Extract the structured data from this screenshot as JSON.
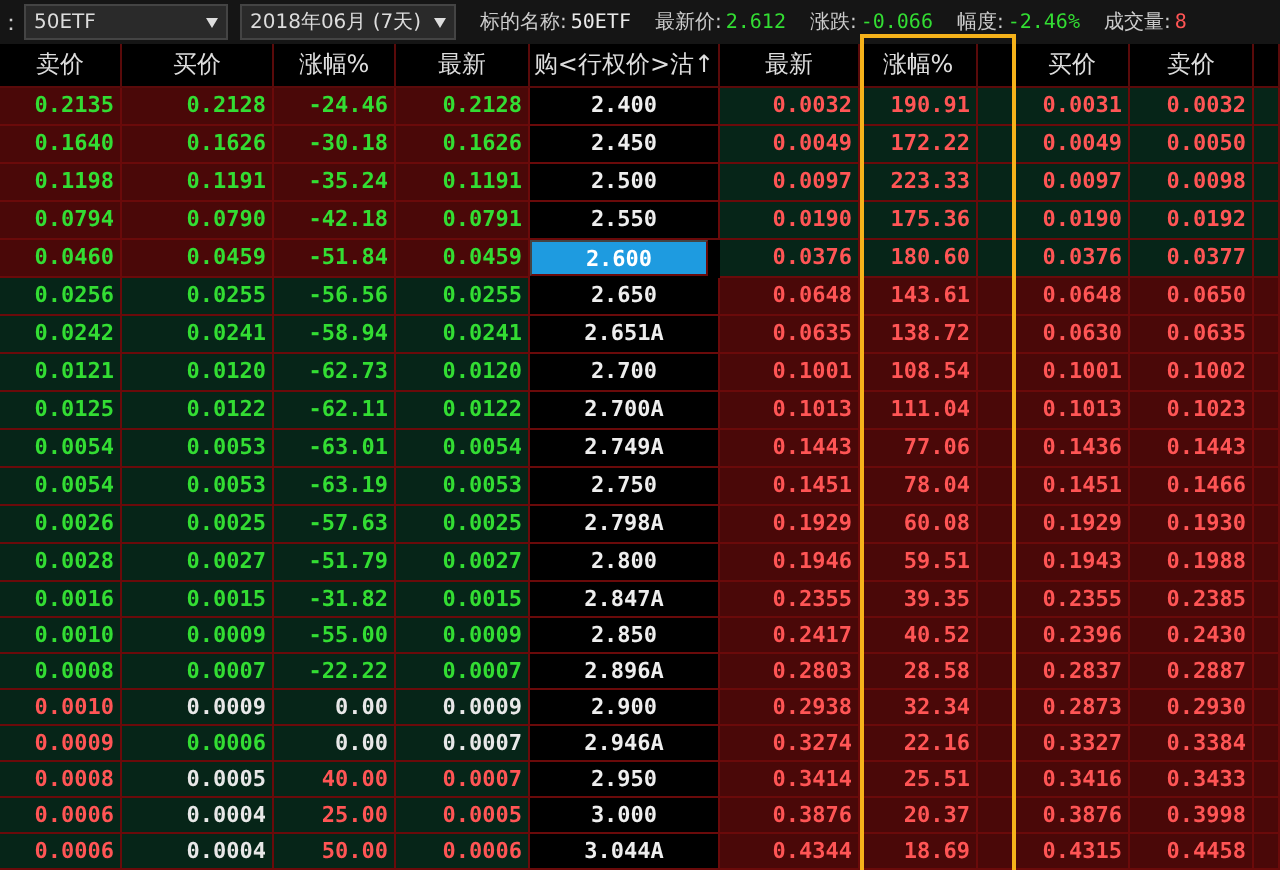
{
  "toolbar": {
    "cut_label": "：",
    "underlying_select": "50ETF",
    "month_select": "2018年06月 (7天)",
    "stats": [
      {
        "label": "标的名称:",
        "value": "50ETF",
        "kind": "flat"
      },
      {
        "label": "最新价:",
        "value": "2.612",
        "kind": "down"
      },
      {
        "label": "涨跌:",
        "value": "-0.066",
        "kind": "down"
      },
      {
        "label": "幅度:",
        "value": "-2.46%",
        "kind": "down"
      },
      {
        "label": "成交量:",
        "value": "8",
        "kind": "up"
      }
    ]
  },
  "table": {
    "columns": [
      "卖价",
      "买价",
      "涨幅%",
      "最新",
      "购<行权价>沽↑",
      "最新",
      "涨幅%",
      "买价",
      "卖价"
    ],
    "rows": [
      {
        "strike": "2.400",
        "selected": false,
        "call_itm": true,
        "call": [
          {
            "text": "0.2135",
            "kind": "down"
          },
          {
            "text": "0.2128",
            "kind": "down"
          },
          {
            "text": "-24.46",
            "kind": "down"
          },
          {
            "text": "0.2128",
            "kind": "down"
          }
        ],
        "put": [
          {
            "text": "0.0032",
            "kind": "up"
          },
          {
            "text": "190.91",
            "kind": "up"
          },
          {
            "text": "0.0031",
            "kind": "up"
          },
          {
            "text": "0.0032",
            "kind": "up"
          }
        ]
      },
      {
        "strike": "2.450",
        "selected": false,
        "call_itm": true,
        "call": [
          {
            "text": "0.1640",
            "kind": "down"
          },
          {
            "text": "0.1626",
            "kind": "down"
          },
          {
            "text": "-30.18",
            "kind": "down"
          },
          {
            "text": "0.1626",
            "kind": "down"
          }
        ],
        "put": [
          {
            "text": "0.0049",
            "kind": "up"
          },
          {
            "text": "172.22",
            "kind": "up"
          },
          {
            "text": "0.0049",
            "kind": "up"
          },
          {
            "text": "0.0050",
            "kind": "up"
          }
        ]
      },
      {
        "strike": "2.500",
        "selected": false,
        "call_itm": true,
        "call": [
          {
            "text": "0.1198",
            "kind": "down"
          },
          {
            "text": "0.1191",
            "kind": "down"
          },
          {
            "text": "-35.24",
            "kind": "down"
          },
          {
            "text": "0.1191",
            "kind": "down"
          }
        ],
        "put": [
          {
            "text": "0.0097",
            "kind": "up"
          },
          {
            "text": "223.33",
            "kind": "up"
          },
          {
            "text": "0.0097",
            "kind": "up"
          },
          {
            "text": "0.0098",
            "kind": "up"
          }
        ]
      },
      {
        "strike": "2.550",
        "selected": false,
        "call_itm": true,
        "call": [
          {
            "text": "0.0794",
            "kind": "down"
          },
          {
            "text": "0.0790",
            "kind": "down"
          },
          {
            "text": "-42.18",
            "kind": "down"
          },
          {
            "text": "0.0791",
            "kind": "down"
          }
        ],
        "put": [
          {
            "text": "0.0190",
            "kind": "up"
          },
          {
            "text": "175.36",
            "kind": "up"
          },
          {
            "text": "0.0190",
            "kind": "up"
          },
          {
            "text": "0.0192",
            "kind": "up"
          }
        ]
      },
      {
        "strike": "2.600",
        "selected": true,
        "call_itm": true,
        "call": [
          {
            "text": "0.0460",
            "kind": "down"
          },
          {
            "text": "0.0459",
            "kind": "down"
          },
          {
            "text": "-51.84",
            "kind": "down"
          },
          {
            "text": "0.0459",
            "kind": "down"
          }
        ],
        "put": [
          {
            "text": "0.0376",
            "kind": "up"
          },
          {
            "text": "180.60",
            "kind": "up"
          },
          {
            "text": "0.0376",
            "kind": "up"
          },
          {
            "text": "0.0377",
            "kind": "up"
          }
        ]
      },
      {
        "strike": "2.650",
        "selected": false,
        "call_itm": false,
        "call": [
          {
            "text": "0.0256",
            "kind": "down"
          },
          {
            "text": "0.0255",
            "kind": "down"
          },
          {
            "text": "-56.56",
            "kind": "down"
          },
          {
            "text": "0.0255",
            "kind": "down"
          }
        ],
        "put": [
          {
            "text": "0.0648",
            "kind": "up"
          },
          {
            "text": "143.61",
            "kind": "up"
          },
          {
            "text": "0.0648",
            "kind": "up"
          },
          {
            "text": "0.0650",
            "kind": "up"
          }
        ]
      },
      {
        "strike": "2.651A",
        "selected": false,
        "call_itm": false,
        "call": [
          {
            "text": "0.0242",
            "kind": "down"
          },
          {
            "text": "0.0241",
            "kind": "down"
          },
          {
            "text": "-58.94",
            "kind": "down"
          },
          {
            "text": "0.0241",
            "kind": "down"
          }
        ],
        "put": [
          {
            "text": "0.0635",
            "kind": "up"
          },
          {
            "text": "138.72",
            "kind": "up"
          },
          {
            "text": "0.0630",
            "kind": "up"
          },
          {
            "text": "0.0635",
            "kind": "up"
          }
        ]
      },
      {
        "strike": "2.700",
        "selected": false,
        "call_itm": false,
        "call": [
          {
            "text": "0.0121",
            "kind": "down"
          },
          {
            "text": "0.0120",
            "kind": "down"
          },
          {
            "text": "-62.73",
            "kind": "down"
          },
          {
            "text": "0.0120",
            "kind": "down"
          }
        ],
        "put": [
          {
            "text": "0.1001",
            "kind": "up"
          },
          {
            "text": "108.54",
            "kind": "up"
          },
          {
            "text": "0.1001",
            "kind": "up"
          },
          {
            "text": "0.1002",
            "kind": "up"
          }
        ]
      },
      {
        "strike": "2.700A",
        "selected": false,
        "call_itm": false,
        "call": [
          {
            "text": "0.0125",
            "kind": "down"
          },
          {
            "text": "0.0122",
            "kind": "down"
          },
          {
            "text": "-62.11",
            "kind": "down"
          },
          {
            "text": "0.0122",
            "kind": "down"
          }
        ],
        "put": [
          {
            "text": "0.1013",
            "kind": "up"
          },
          {
            "text": "111.04",
            "kind": "up"
          },
          {
            "text": "0.1013",
            "kind": "up"
          },
          {
            "text": "0.1023",
            "kind": "up"
          }
        ]
      },
      {
        "strike": "2.749A",
        "selected": false,
        "call_itm": false,
        "call": [
          {
            "text": "0.0054",
            "kind": "down"
          },
          {
            "text": "0.0053",
            "kind": "down"
          },
          {
            "text": "-63.01",
            "kind": "down"
          },
          {
            "text": "0.0054",
            "kind": "down"
          }
        ],
        "put": [
          {
            "text": "0.1443",
            "kind": "up"
          },
          {
            "text": "77.06",
            "kind": "up"
          },
          {
            "text": "0.1436",
            "kind": "up"
          },
          {
            "text": "0.1443",
            "kind": "up"
          }
        ]
      },
      {
        "strike": "2.750",
        "selected": false,
        "call_itm": false,
        "call": [
          {
            "text": "0.0054",
            "kind": "down"
          },
          {
            "text": "0.0053",
            "kind": "down"
          },
          {
            "text": "-63.19",
            "kind": "down"
          },
          {
            "text": "0.0053",
            "kind": "down"
          }
        ],
        "put": [
          {
            "text": "0.1451",
            "kind": "up"
          },
          {
            "text": "78.04",
            "kind": "up"
          },
          {
            "text": "0.1451",
            "kind": "up"
          },
          {
            "text": "0.1466",
            "kind": "up"
          }
        ]
      },
      {
        "strike": "2.798A",
        "selected": false,
        "call_itm": false,
        "call": [
          {
            "text": "0.0026",
            "kind": "down"
          },
          {
            "text": "0.0025",
            "kind": "down"
          },
          {
            "text": "-57.63",
            "kind": "down"
          },
          {
            "text": "0.0025",
            "kind": "down"
          }
        ],
        "put": [
          {
            "text": "0.1929",
            "kind": "up"
          },
          {
            "text": "60.08",
            "kind": "up"
          },
          {
            "text": "0.1929",
            "kind": "up"
          },
          {
            "text": "0.1930",
            "kind": "up"
          }
        ]
      },
      {
        "strike": "2.800",
        "selected": false,
        "call_itm": false,
        "call": [
          {
            "text": "0.0028",
            "kind": "down"
          },
          {
            "text": "0.0027",
            "kind": "down"
          },
          {
            "text": "-51.79",
            "kind": "down"
          },
          {
            "text": "0.0027",
            "kind": "down"
          }
        ],
        "put": [
          {
            "text": "0.1946",
            "kind": "up"
          },
          {
            "text": "59.51",
            "kind": "up"
          },
          {
            "text": "0.1943",
            "kind": "up"
          },
          {
            "text": "0.1988",
            "kind": "up"
          }
        ]
      },
      {
        "strike": "2.847A",
        "selected": false,
        "call_itm": false,
        "call": [
          {
            "text": "0.0016",
            "kind": "down"
          },
          {
            "text": "0.0015",
            "kind": "down"
          },
          {
            "text": "-31.82",
            "kind": "down"
          },
          {
            "text": "0.0015",
            "kind": "down"
          }
        ],
        "put": [
          {
            "text": "0.2355",
            "kind": "up"
          },
          {
            "text": "39.35",
            "kind": "up"
          },
          {
            "text": "0.2355",
            "kind": "up"
          },
          {
            "text": "0.2385",
            "kind": "up"
          }
        ]
      },
      {
        "strike": "2.850",
        "selected": false,
        "call_itm": false,
        "call": [
          {
            "text": "0.0010",
            "kind": "down"
          },
          {
            "text": "0.0009",
            "kind": "down"
          },
          {
            "text": "-55.00",
            "kind": "down"
          },
          {
            "text": "0.0009",
            "kind": "down"
          }
        ],
        "put": [
          {
            "text": "0.2417",
            "kind": "up"
          },
          {
            "text": "40.52",
            "kind": "up"
          },
          {
            "text": "0.2396",
            "kind": "up"
          },
          {
            "text": "0.2430",
            "kind": "up"
          }
        ]
      },
      {
        "strike": "2.896A",
        "selected": false,
        "call_itm": false,
        "call": [
          {
            "text": "0.0008",
            "kind": "down"
          },
          {
            "text": "0.0007",
            "kind": "down"
          },
          {
            "text": "-22.22",
            "kind": "down"
          },
          {
            "text": "0.0007",
            "kind": "down"
          }
        ],
        "put": [
          {
            "text": "0.2803",
            "kind": "up"
          },
          {
            "text": "28.58",
            "kind": "up"
          },
          {
            "text": "0.2837",
            "kind": "up"
          },
          {
            "text": "0.2887",
            "kind": "up"
          }
        ]
      },
      {
        "strike": "2.900",
        "selected": false,
        "call_itm": false,
        "call": [
          {
            "text": "0.0010",
            "kind": "up"
          },
          {
            "text": "0.0009",
            "kind": "flat"
          },
          {
            "text": "0.00",
            "kind": "flat"
          },
          {
            "text": "0.0009",
            "kind": "flat"
          }
        ],
        "put": [
          {
            "text": "0.2938",
            "kind": "up"
          },
          {
            "text": "32.34",
            "kind": "up"
          },
          {
            "text": "0.2873",
            "kind": "up"
          },
          {
            "text": "0.2930",
            "kind": "up"
          }
        ]
      },
      {
        "strike": "2.946A",
        "selected": false,
        "call_itm": false,
        "call": [
          {
            "text": "0.0009",
            "kind": "up"
          },
          {
            "text": "0.0006",
            "kind": "down"
          },
          {
            "text": "0.00",
            "kind": "flat"
          },
          {
            "text": "0.0007",
            "kind": "flat"
          }
        ],
        "put": [
          {
            "text": "0.3274",
            "kind": "up"
          },
          {
            "text": "22.16",
            "kind": "up"
          },
          {
            "text": "0.3327",
            "kind": "up"
          },
          {
            "text": "0.3384",
            "kind": "up"
          }
        ]
      },
      {
        "strike": "2.950",
        "selected": false,
        "call_itm": false,
        "call": [
          {
            "text": "0.0008",
            "kind": "up"
          },
          {
            "text": "0.0005",
            "kind": "flat"
          },
          {
            "text": "40.00",
            "kind": "up"
          },
          {
            "text": "0.0007",
            "kind": "up"
          }
        ],
        "put": [
          {
            "text": "0.3414",
            "kind": "up"
          },
          {
            "text": "25.51",
            "kind": "up"
          },
          {
            "text": "0.3416",
            "kind": "up"
          },
          {
            "text": "0.3433",
            "kind": "up"
          }
        ]
      },
      {
        "strike": "3.000",
        "selected": false,
        "call_itm": false,
        "call": [
          {
            "text": "0.0006",
            "kind": "up"
          },
          {
            "text": "0.0004",
            "kind": "flat"
          },
          {
            "text": "25.00",
            "kind": "up"
          },
          {
            "text": "0.0005",
            "kind": "up"
          }
        ],
        "put": [
          {
            "text": "0.3876",
            "kind": "up"
          },
          {
            "text": "20.37",
            "kind": "up"
          },
          {
            "text": "0.3876",
            "kind": "up"
          },
          {
            "text": "0.3998",
            "kind": "up"
          }
        ]
      },
      {
        "strike": "3.044A",
        "selected": false,
        "call_itm": false,
        "call": [
          {
            "text": "0.0006",
            "kind": "up"
          },
          {
            "text": "0.0004",
            "kind": "flat"
          },
          {
            "text": "50.00",
            "kind": "up"
          },
          {
            "text": "0.0006",
            "kind": "up"
          }
        ],
        "put": [
          {
            "text": "0.4344",
            "kind": "up"
          },
          {
            "text": "18.69",
            "kind": "up"
          },
          {
            "text": "0.4315",
            "kind": "up"
          },
          {
            "text": "0.4458",
            "kind": "up"
          }
        ]
      }
    ]
  }
}
